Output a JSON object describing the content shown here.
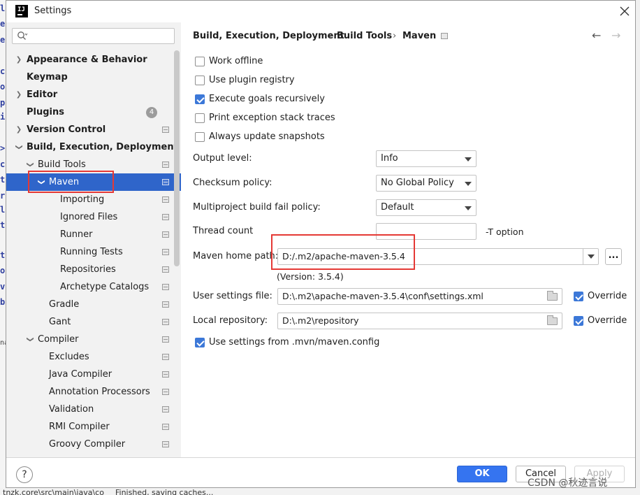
{
  "window": {
    "title": "Settings"
  },
  "background": {
    "left_chars": [
      "l",
      "e",
      "e",
      "c",
      "o",
      "p",
      "i",
      ">",
      "c",
      "t",
      "r",
      "l",
      "t",
      "t",
      "o",
      "v",
      "b",
      "na"
    ],
    "bottom_text": "tnzk.core\\src\\main\\java\\co",
    "bottom_text2": "Finished, saving caches..."
  },
  "sidebar": {
    "search_placeholder": "Q↓",
    "items": [
      {
        "label": "Appearance & Behavior",
        "bold": true,
        "arrow": "right"
      },
      {
        "label": "Keymap",
        "bold": true,
        "arrow": ""
      },
      {
        "label": "Editor",
        "bold": true,
        "arrow": "right"
      },
      {
        "label": "Plugins",
        "bold": true,
        "arrow": "",
        "badge": "4"
      },
      {
        "label": "Version Control",
        "bold": true,
        "arrow": "right"
      },
      {
        "label": "Build, Execution, Deployment",
        "bold": true,
        "arrow": "down"
      },
      {
        "label": "Build Tools",
        "arrow": "down"
      },
      {
        "label": "Maven",
        "arrow": "down",
        "selected": true
      },
      {
        "label": "Importing"
      },
      {
        "label": "Ignored Files"
      },
      {
        "label": "Runner"
      },
      {
        "label": "Running Tests"
      },
      {
        "label": "Repositories"
      },
      {
        "label": "Archetype Catalogs"
      },
      {
        "label": "Gradle"
      },
      {
        "label": "Gant"
      },
      {
        "label": "Compiler",
        "arrow": "down"
      },
      {
        "label": "Excludes"
      },
      {
        "label": "Java Compiler"
      },
      {
        "label": "Annotation Processors"
      },
      {
        "label": "Validation"
      },
      {
        "label": "RMI Compiler"
      },
      {
        "label": "Groovy Compiler"
      }
    ]
  },
  "breadcrumb": {
    "part1": "Build, Execution, Deployment",
    "sep": "›",
    "part2": "Build Tools",
    "part3": "Maven"
  },
  "checkboxes": [
    {
      "label": "Work offline",
      "checked": false
    },
    {
      "label": "Use plugin registry",
      "checked": false
    },
    {
      "label": "Execute goals recursively",
      "checked": true
    },
    {
      "label": "Print exception stack traces",
      "checked": false
    },
    {
      "label": "Always update snapshots",
      "checked": false
    }
  ],
  "fields": {
    "output_level": {
      "label": "Output level:",
      "value": "Info"
    },
    "checksum_policy": {
      "label": "Checksum policy:",
      "value": "No Global Policy"
    },
    "fail_policy": {
      "label": "Multiproject build fail policy:",
      "value": "Default"
    },
    "thread_count": {
      "label": "Thread count",
      "value": "",
      "hint": "-T option"
    },
    "maven_home": {
      "label": "Maven home path:",
      "value": "D:/.m2/apache-maven-3.5.4",
      "version": "(Version: 3.5.4)",
      "browse": "..."
    },
    "user_settings": {
      "label": "User settings file:",
      "value": "D:\\.m2\\apache-maven-3.5.4\\conf\\settings.xml",
      "override_label": "Override",
      "override": true
    },
    "local_repo": {
      "label": "Local repository:",
      "value": "D:\\.m2\\repository",
      "override_label": "Override",
      "override": true
    },
    "mvn_config": {
      "label": "Use settings from .mvn/maven.config",
      "checked": true
    }
  },
  "footer": {
    "help": "?",
    "ok": "OK",
    "cancel": "Cancel",
    "apply": "Apply"
  },
  "watermark": "CSDN @秋迹言说",
  "colors": {
    "accent": "#3574f0",
    "selection": "#2f65ca",
    "highlight_box": "#e53935"
  }
}
